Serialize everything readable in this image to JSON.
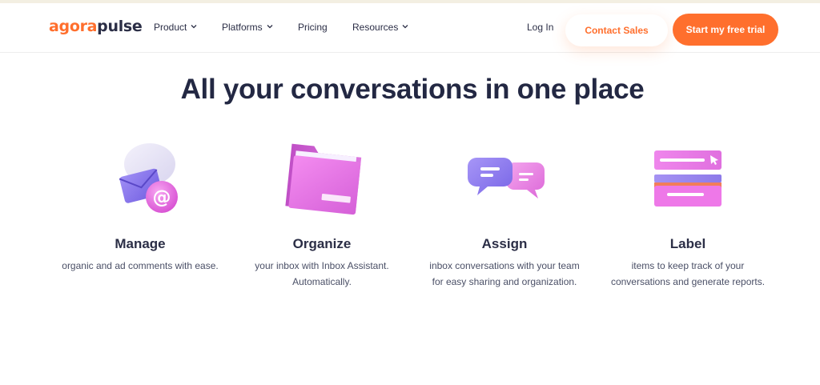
{
  "brand": {
    "logo_part1": "agora",
    "logo_part2": "pulse"
  },
  "nav": {
    "items": [
      {
        "label": "Product",
        "dropdown": true
      },
      {
        "label": "Platforms",
        "dropdown": true
      },
      {
        "label": "Pricing",
        "dropdown": false
      },
      {
        "label": "Resources",
        "dropdown": true
      }
    ],
    "login_label": "Log In",
    "contact_label": "Contact Sales",
    "trial_label": "Start my free trial"
  },
  "headline": "All your conversations in one place",
  "features": [
    {
      "title": "Manage",
      "description": "organic and ad comments with ease.",
      "icon": "envelope-at-icon"
    },
    {
      "title": "Organize",
      "description": "your inbox with Inbox Assistant. Automatically.",
      "icon": "folder-icon"
    },
    {
      "title": "Assign",
      "description": "inbox conversations with your team for easy sharing and organization.",
      "icon": "chat-bubbles-icon"
    },
    {
      "title": "Label",
      "description": "items to keep track of your conversations and generate reports.",
      "icon": "label-stack-icon"
    }
  ],
  "colors": {
    "accent": "#ff6f2d",
    "text": "#2b2e46",
    "purple": "#8b7cf0",
    "pink": "#e46ee0"
  }
}
